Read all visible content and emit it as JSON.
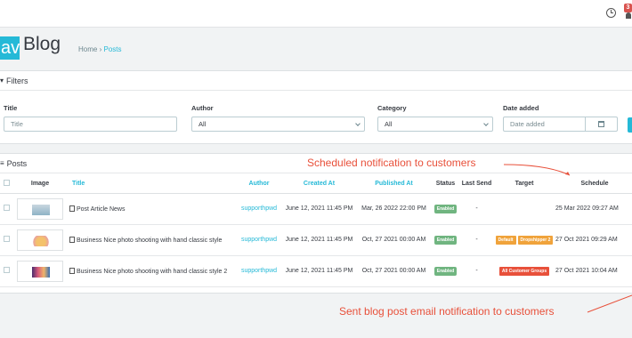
{
  "topbar": {
    "clock_icon": "clock-icon",
    "notification_count": "3",
    "notification_icon": "bell-icon"
  },
  "header": {
    "logo_text": "av",
    "title": "Blog",
    "breadcrumb": [
      "Home",
      "Posts"
    ]
  },
  "filters": {
    "heading": "Filters",
    "title_label": "Title",
    "title_placeholder": "Title",
    "author_label": "Author",
    "author_value": "All",
    "category_label": "Category",
    "category_value": "All",
    "date_label": "Date added",
    "date_placeholder": "Date added"
  },
  "posts": {
    "heading": "Posts",
    "columns": [
      "Image",
      "Title",
      "Author",
      "Created At",
      "Published At",
      "Status",
      "Last Send",
      "Target",
      "Schedule"
    ],
    "rows": [
      {
        "title": "Post Article News",
        "author": "supporthpwd",
        "created": "June 12, 2021 11:45 PM",
        "published": "Mar, 26 2022 22:00 PM",
        "status": "Enabled",
        "last_send": "-",
        "targets": [],
        "schedule": "25 Mar 2022 09:27 AM"
      },
      {
        "title": "Business Nice photo shooting with hand classic style",
        "author": "supporthpwd",
        "created": "June 12, 2021 11:45 PM",
        "published": "Oct, 27 2021 00:00 AM",
        "status": "Enabled",
        "last_send": "-",
        "targets": [
          "Default",
          "Dropshipper 2"
        ],
        "schedule": "27 Oct 2021 09:29 AM"
      },
      {
        "title": "Business Nice photo shooting with hand classic style 2",
        "author": "supporthpwd",
        "created": "June 12, 2021 11:45 PM",
        "published": "Oct, 27 2021 00:00 AM",
        "status": "Enabled",
        "last_send": "-",
        "targets": [
          "All Customer Groups"
        ],
        "schedule": "27 Oct 2021 10:04 AM"
      }
    ]
  },
  "annotations": {
    "scheduled": "Scheduled notification to customers",
    "sent": "Sent blog post email notification to customers"
  },
  "colors": {
    "accent": "#25b9d7",
    "enabled": "#70b580",
    "tag_default": "#f0a33b",
    "tag_dropshipper": "#f0a33b",
    "tag_all_groups": "#e8503a",
    "annotation": "#e8503a"
  }
}
